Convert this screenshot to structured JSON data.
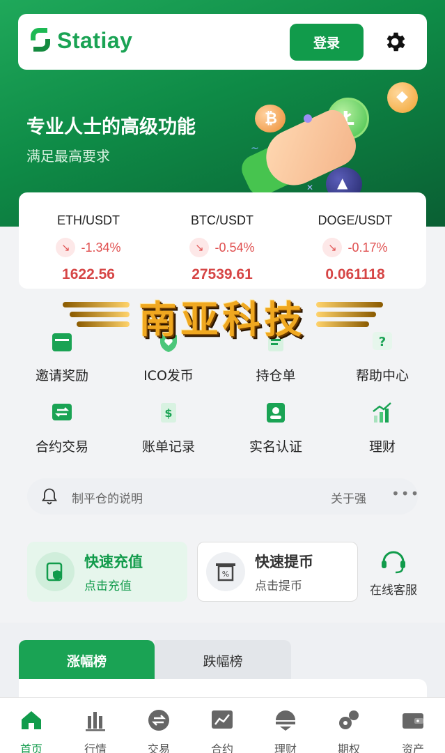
{
  "header": {
    "brand": "Statiay",
    "login_label": "登录"
  },
  "hero": {
    "title": "专业人士的高级功能",
    "subtitle": "满足最高要求"
  },
  "tickers": [
    {
      "pair": "ETH/USDT",
      "change": "-1.34%",
      "price": "1622.56"
    },
    {
      "pair": "BTC/USDT",
      "change": "-0.54%",
      "price": "27539.61"
    },
    {
      "pair": "DOGE/USDT",
      "change": "-0.17%",
      "price": "0.061118"
    }
  ],
  "watermark": "南亚科技",
  "menu": [
    {
      "label": "邀请奖励",
      "icon": "gift-icon"
    },
    {
      "label": "ICO发币",
      "icon": "shield-heart-icon"
    },
    {
      "label": "持仓单",
      "icon": "document-icon"
    },
    {
      "label": "帮助中心",
      "icon": "help-icon"
    },
    {
      "label": "合约交易",
      "icon": "exchange-icon"
    },
    {
      "label": "账单记录",
      "icon": "bill-icon"
    },
    {
      "label": "实名认证",
      "icon": "id-card-icon"
    },
    {
      "label": "理财",
      "icon": "growth-chart-icon"
    }
  ],
  "notice": {
    "text": "制平仓的说明",
    "text_right": "关于强",
    "more": "•••"
  },
  "quick_actions": {
    "deposit_title": "快速充值",
    "deposit_sub": "点击充值",
    "withdraw_title": "快速提币",
    "withdraw_sub": "点击提币",
    "support_label": "在线客服"
  },
  "rank_tabs": {
    "gainers": "涨幅榜",
    "losers": "跌幅榜"
  },
  "bottom_nav": [
    {
      "label": "首页",
      "icon": "home-icon",
      "active": true
    },
    {
      "label": "行情",
      "icon": "bars-icon",
      "active": false
    },
    {
      "label": "交易",
      "icon": "swap-icon",
      "active": false
    },
    {
      "label": "合约",
      "icon": "contract-chart-icon",
      "active": false
    },
    {
      "label": "理财",
      "icon": "finance-icon",
      "active": false
    },
    {
      "label": "期权",
      "icon": "options-icon",
      "active": false
    },
    {
      "label": "资产",
      "icon": "wallet-icon",
      "active": false
    }
  ],
  "colors": {
    "brand_green": "#119b4b",
    "negative_red": "#e05050",
    "text_dark": "#222222"
  }
}
